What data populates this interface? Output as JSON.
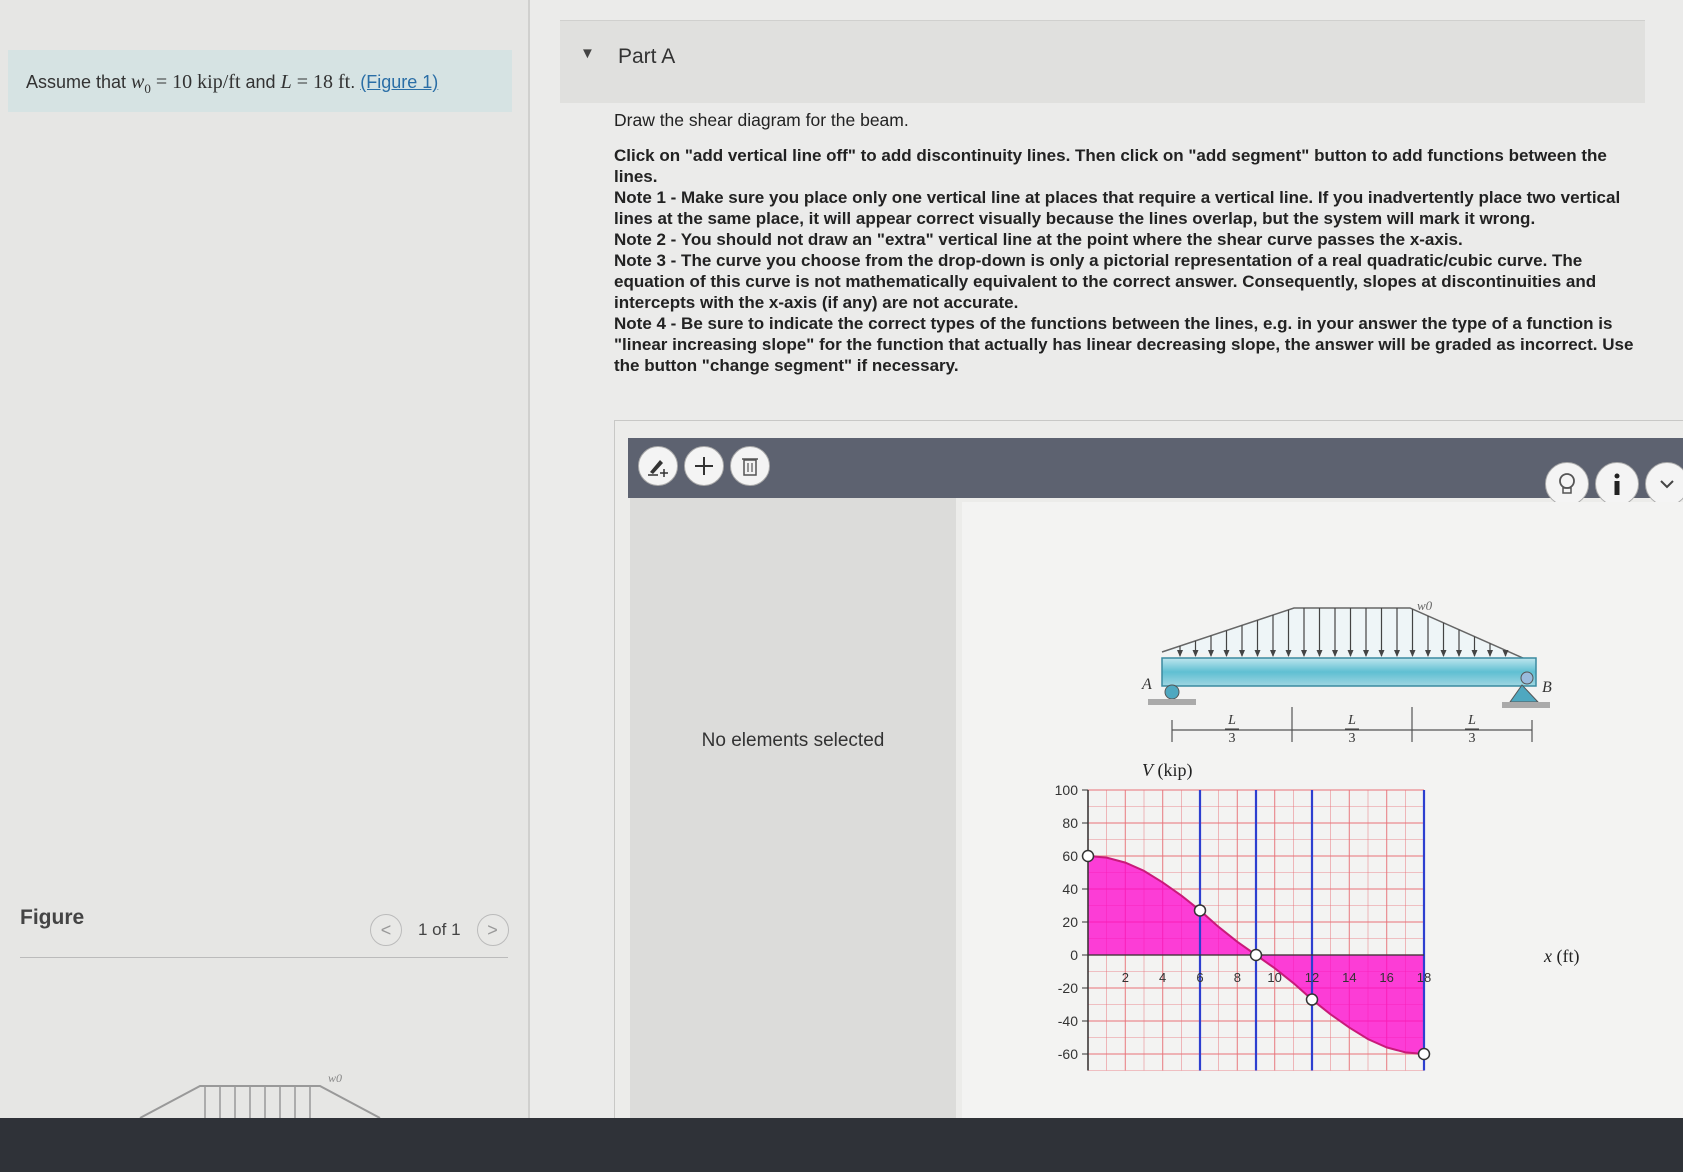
{
  "problem": {
    "prefix": "Assume that ",
    "w0_sym": "w",
    "w0_sub": "0",
    "eq1": " = 10 ",
    "unit1": "kip/ft",
    "and": " and ",
    "L_sym": "L",
    "eq2": " = 18 ",
    "unit2": "ft",
    "dot": ". ",
    "figure_link": "(Figure 1)"
  },
  "figure_panel": {
    "label": "Figure",
    "count": "1 of 1",
    "prev": "<",
    "next": ">",
    "thumb_label": "w0"
  },
  "part": {
    "caret": "▼",
    "title": "Part A"
  },
  "question": {
    "lead": "Draw the shear diagram for the beam.",
    "instructions": [
      "Click on \"add vertical line off\" to add discontinuity lines. Then click on \"add segment\" button to add functions between the lines.",
      "Note 1 - Make sure you place only one vertical line at places that require a vertical line. If you inadvertently place two vertical lines at the same place, it will appear correct visually because the lines overlap, but the system will mark it wrong.",
      "Note 2 - You should not draw an \"extra\" vertical line at the point where the shear curve passes the x-axis.",
      "Note 3 - The curve you choose from the drop-down is only a pictorial representation of a real quadratic/cubic curve. The equation of this curve is not mathematically equivalent to the correct answer. Consequently, slopes at discontinuities and intercepts with the x-axis (if any) are not accurate.",
      "Note 4 - Be sure to indicate the correct types of the functions between the lines, e.g. in your answer the type of a function is \"linear increasing slope\" for the function that actually has linear decreasing slope, the answer will be graded as incorrect. Use the button \"change segment\" if necessary."
    ]
  },
  "toolbar": {
    "icons": [
      "pencil-plus-icon",
      "plus-icon",
      "trash-icon",
      "lightbulb-icon",
      "info-icon",
      "chevron-down-icon"
    ]
  },
  "props": {
    "empty_text": "No elements selected"
  },
  "beam": {
    "load_label": "w0",
    "support_a": "A",
    "support_b": "B",
    "span_num": "L",
    "span_den": "3"
  },
  "colors": {
    "fill": "#ff00cc",
    "curve": "#c91a7a",
    "grid": "#e8737a",
    "vline": "#2d3fd0",
    "toolbar": "#5d6270"
  },
  "chart_data": {
    "type": "area",
    "ylabel_sym": "V",
    "ylabel_unit": "(kip)",
    "xlabel_sym": "x",
    "xlabel_unit": "(ft)",
    "xlim": [
      0,
      18
    ],
    "ylim": [
      -60,
      100
    ],
    "x_ticks": [
      2,
      4,
      6,
      8,
      10,
      12,
      14,
      16,
      18
    ],
    "y_ticks": [
      100,
      80,
      60,
      40,
      20,
      0,
      -20,
      -40,
      -60
    ],
    "vertical_lines_x": [
      6,
      9,
      12
    ],
    "series": [
      {
        "x": [
          0,
          1,
          2,
          3,
          4,
          5,
          6,
          7,
          8,
          9,
          10,
          11,
          12,
          13,
          14,
          15,
          16,
          17,
          18
        ],
        "values": [
          60,
          59,
          56,
          51,
          44,
          36,
          27,
          17,
          8,
          0,
          -8,
          -17,
          -27,
          -36,
          -44,
          -51,
          -56,
          -59,
          -60
        ]
      }
    ],
    "markers": [
      {
        "x": 0,
        "y": 60
      },
      {
        "x": 6,
        "y": 27
      },
      {
        "x": 9,
        "y": 0
      },
      {
        "x": 12,
        "y": -27
      },
      {
        "x": 18,
        "y": -60
      }
    ]
  }
}
